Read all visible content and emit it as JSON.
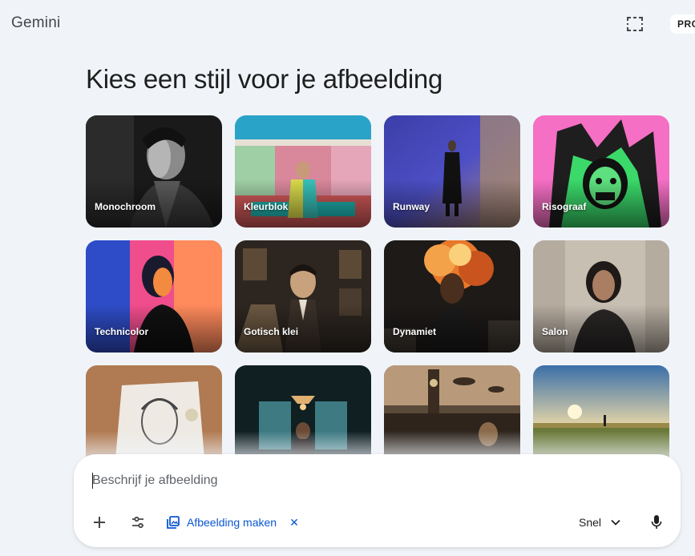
{
  "app": {
    "brand": "Gemini",
    "badge": "PRO"
  },
  "heading": "Kies een stijl voor je afbeelding",
  "styles": [
    {
      "label": "Monochroom",
      "icon": "portrait-bw"
    },
    {
      "label": "Kleurblok",
      "icon": "color-block-room"
    },
    {
      "label": "Runway",
      "icon": "runway-model"
    },
    {
      "label": "Risograaf",
      "icon": "risograph-punk"
    },
    {
      "label": "Technicolor",
      "icon": "technicolor-portrait"
    },
    {
      "label": "Gotisch klei",
      "icon": "gothic-clay"
    },
    {
      "label": "Dynamiet",
      "icon": "explosion"
    },
    {
      "label": "Salon",
      "icon": "salon-portrait"
    },
    {
      "label": "",
      "icon": "pencil-sketch"
    },
    {
      "label": "",
      "icon": "dark-interior"
    },
    {
      "label": "",
      "icon": "steampunk-city"
    },
    {
      "label": "",
      "icon": "sunset-field"
    }
  ],
  "composer": {
    "placeholder": "Beschrijf je afbeelding",
    "tool_chip": "Afbeelding maken",
    "mode": "Snel"
  },
  "colors": {
    "accent": "#0b57d0",
    "background": "#f0f4f9"
  }
}
